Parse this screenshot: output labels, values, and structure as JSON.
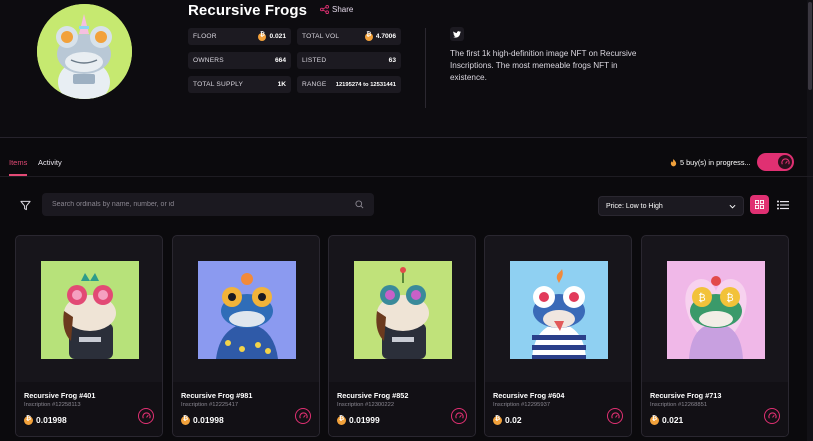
{
  "collection": {
    "title": "Recursive Frogs",
    "share_label": "Share",
    "description": "The first 1k high-definition image NFT on Recursive Inscriptions. The most memeable frogs NFT in existence."
  },
  "stats": {
    "floor": {
      "label": "FLOOR",
      "value": "0.021"
    },
    "total_vol": {
      "label": "TOTAL VOL",
      "value": "4.7006"
    },
    "owners": {
      "label": "OWNERS",
      "value": "664"
    },
    "listed": {
      "label": "LISTED",
      "value": "63"
    },
    "total_supply": {
      "label": "TOTAL SUPPLY",
      "value": "1K"
    },
    "range": {
      "label": "RANGE",
      "value": "12195274 to 12531441"
    }
  },
  "tabs": {
    "items": "Items",
    "activity": "Activity"
  },
  "progress": {
    "text": "5 buy(s) in progress..."
  },
  "search": {
    "placeholder": "Search ordinals by name, number, or id"
  },
  "sort": {
    "selected": "Price: Low to High"
  },
  "colors": {
    "accent": "#e03072",
    "bitcoin": "#f2a13b",
    "background": "#0b0a0d"
  },
  "cards": [
    {
      "name": "Recursive Frog #401",
      "inscription": "Inscription #12258113",
      "price": "0.01998",
      "bg": "#b7e27a"
    },
    {
      "name": "Recursive Frog #981",
      "inscription": "Inscription #12225417",
      "price": "0.01998",
      "bg": "#8b9af0"
    },
    {
      "name": "Recursive Frog #852",
      "inscription": "Inscription #12300222",
      "price": "0.01999",
      "bg": "#c0e27a"
    },
    {
      "name": "Recursive Frog #604",
      "inscription": "Inscription #12295937",
      "price": "0.02",
      "bg": "#8fd0f2"
    },
    {
      "name": "Recursive Frog #713",
      "inscription": "Inscription #12268851",
      "price": "0.021",
      "bg": "#f0b8e8"
    }
  ]
}
